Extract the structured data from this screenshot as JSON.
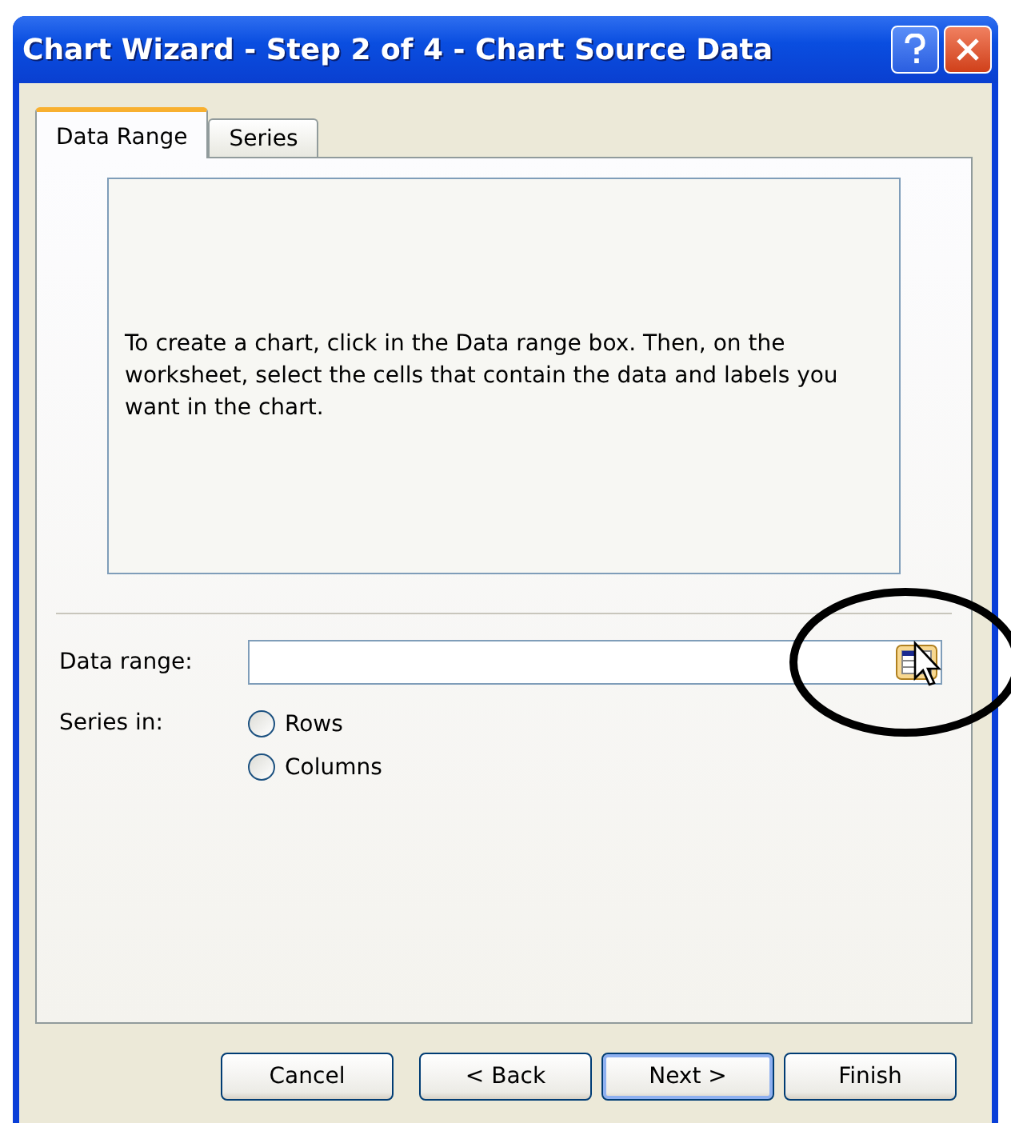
{
  "window": {
    "title": "Chart Wizard - Step 2 of 4 - Chart Source Data"
  },
  "tabs": [
    {
      "label": "Data Range",
      "selected": true
    },
    {
      "label": "Series",
      "selected": false
    }
  ],
  "preview": {
    "message": "To create a chart, click in the Data range box. Then, on the worksheet, select the cells that contain the data and labels you want in the chart."
  },
  "data_range": {
    "label": "Data range:"
  },
  "series_in": {
    "label": "Series in:",
    "options": [
      {
        "label": "Rows",
        "selected": false
      },
      {
        "label": "Columns",
        "selected": false
      }
    ]
  },
  "buttons": [
    {
      "label": "Cancel",
      "focused": false
    },
    {
      "label": "< Back",
      "focused": false
    },
    {
      "label": "Next >",
      "focused": true
    },
    {
      "label": "Finish",
      "focused": false
    }
  ]
}
